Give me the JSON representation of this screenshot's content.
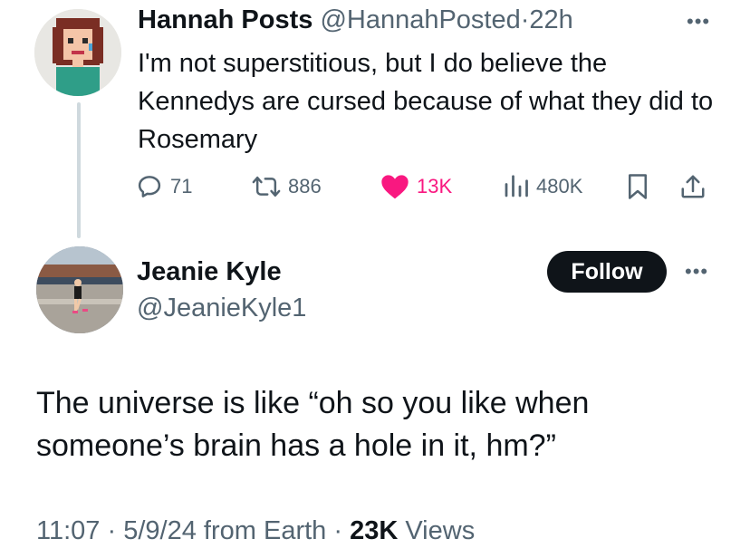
{
  "quoted_tweet": {
    "author_name": "Hannah Posts",
    "author_handle": "@HannahPosted",
    "separator": "·",
    "time_ago": "22h",
    "text": "I'm not superstitious, but I do believe the Kennedys are cursed because of what they did to Rosemary",
    "more_icon": "more-horizontal-icon",
    "metrics": {
      "replies": "71",
      "reposts": "886",
      "likes": "13K",
      "views": "480K"
    },
    "like_color": "#f91880"
  },
  "main_tweet": {
    "author_name": "Jeanie Kyle",
    "author_handle": "@JeanieKyle1",
    "follow_label": "Follow",
    "more_icon": "more-horizontal-icon",
    "text": "The universe is like “oh so you like when someone’s brain has a hole in it, hm?”",
    "meta": {
      "time": "11:07",
      "sep1": "·",
      "date": "5/9/24",
      "source": "from Earth",
      "sep2": "·",
      "views_count": "23K",
      "views_label": "Views"
    }
  },
  "colors": {
    "text_primary": "#0f1419",
    "text_secondary": "#536471",
    "thread_line": "#cfd9de",
    "follow_bg": "#0f1419"
  }
}
